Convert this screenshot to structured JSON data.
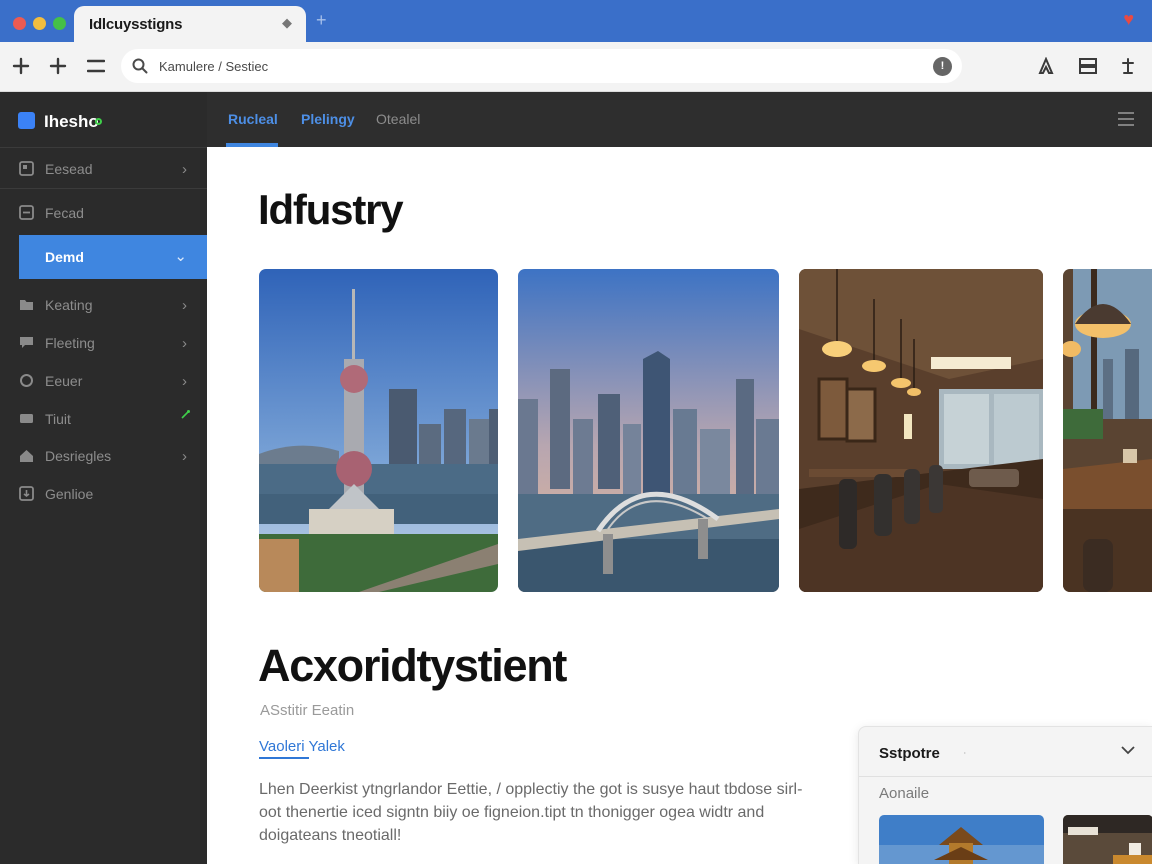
{
  "browser": {
    "tab_title": "Idlcuysstigns",
    "tab_close": "◆",
    "new_tab": "+",
    "url_text": "Kamulere / Sestiec",
    "url_badge": "!"
  },
  "sidebar": {
    "brand": "Ihesho",
    "items": [
      {
        "label": "Eesead"
      },
      {
        "label": "Fecad"
      },
      {
        "label": "Demd"
      },
      {
        "label": "Keating"
      },
      {
        "label": "Fleeting"
      },
      {
        "label": "Eeuer"
      },
      {
        "label": "Tiuit"
      },
      {
        "label": "Desriegles"
      },
      {
        "label": "Genlioe"
      }
    ]
  },
  "main": {
    "tabs": [
      {
        "label": "Rucleal"
      },
      {
        "label": "Plelingy"
      },
      {
        "label": "Otealel"
      }
    ],
    "heading": "Idfustry",
    "photos": [
      {
        "alt": "city skyline tv tower"
      },
      {
        "alt": "city skyline bridge"
      },
      {
        "alt": "restaurant interior"
      },
      {
        "alt": "cafe interior"
      }
    ],
    "section_title": "Acxoridtystient",
    "subtitle": "ASstitir Eeatin",
    "link_text": "Vaoleri Yalek",
    "paragraph": "Lhen Deerkist ytngrlandor Eettie, / opplectiy the got is susye haut tbdose sirl-oot thenertie iced signtn biiy oe figneion.tipt tn thonigger ogea widtr and doigateans tneotiall!"
  },
  "panel": {
    "title": "Sstpotre",
    "small_text": "‧",
    "label": "Aonaile"
  },
  "colors": {
    "accent": "#3f86e0",
    "tab_bar": "#3a6fc9",
    "sidebar_bg": "#2b2b2b"
  }
}
